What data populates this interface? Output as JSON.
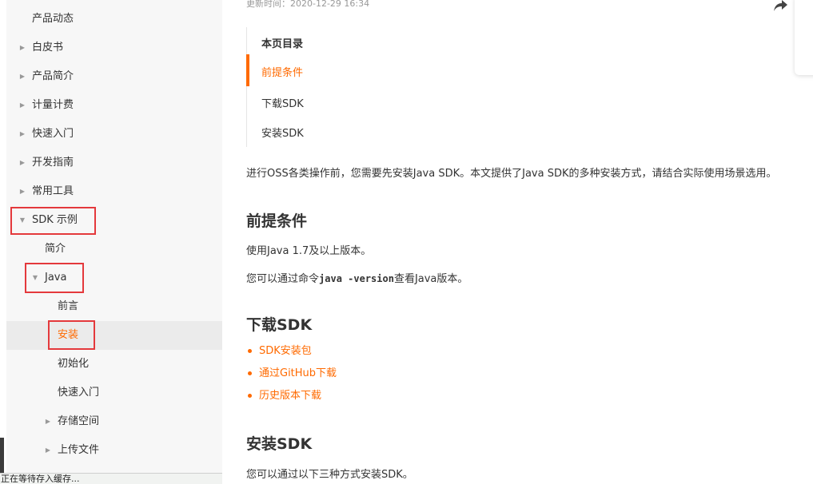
{
  "sidebar": {
    "items": [
      {
        "label": "产品动态",
        "caret": ""
      },
      {
        "label": "白皮书",
        "caret": "▶"
      },
      {
        "label": "产品简介",
        "caret": "▶"
      },
      {
        "label": "计量计费",
        "caret": "▶"
      },
      {
        "label": "快速入门",
        "caret": "▶"
      },
      {
        "label": "开发指南",
        "caret": "▶"
      },
      {
        "label": "常用工具",
        "caret": "▶"
      },
      {
        "label": "SDK 示例",
        "caret": "▼"
      },
      {
        "label": "简介",
        "caret": ""
      },
      {
        "label": "Java",
        "caret": "▼"
      },
      {
        "label": "前言",
        "caret": ""
      },
      {
        "label": "安装",
        "caret": ""
      },
      {
        "label": "初始化",
        "caret": ""
      },
      {
        "label": "快速入门",
        "caret": ""
      },
      {
        "label": "存储空间",
        "caret": "▶"
      },
      {
        "label": "上传文件",
        "caret": "▶"
      }
    ]
  },
  "status_bar": {
    "text": "正在等待存入缓存..."
  },
  "article": {
    "updated": "更新时间：2020-12-29 16:34",
    "toc": {
      "title": "本页目录",
      "items": [
        "前提条件",
        "下载SDK",
        "安装SDK"
      ]
    },
    "intro": "进行OSS各类操作前，您需要先安装Java SDK。本文提供了Java SDK的多种安装方式，请结合实际使用场景选用。",
    "sections": {
      "prereq": {
        "title": "前提条件",
        "p1": "使用Java 1.7及以上版本。",
        "p2_prefix": "您可以通过命令",
        "p2_code": "java -version",
        "p2_suffix": "查看Java版本。"
      },
      "download": {
        "title": "下载SDK",
        "links": [
          "SDK安装包",
          "通过GitHub下载",
          "历史版本下载"
        ]
      },
      "install": {
        "title": "安装SDK",
        "p1": "您可以通过以下三种方式安装SDK。"
      }
    }
  },
  "colors": {
    "accent": "#ff6a00",
    "highlight_box": "#e4393c",
    "sidebar_bg": "#f7f7f7"
  }
}
